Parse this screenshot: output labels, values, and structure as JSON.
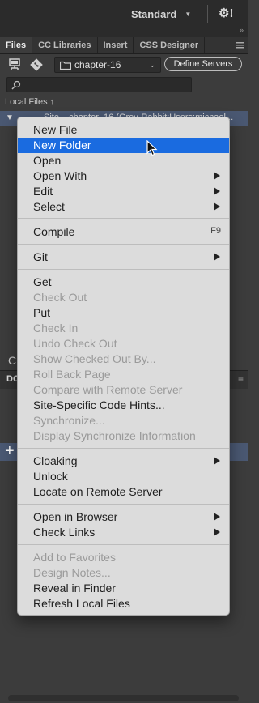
{
  "topbar": {
    "workspace": "Standard"
  },
  "tabs": [
    {
      "label": "Files",
      "active": true
    },
    {
      "label": "CC Libraries",
      "active": false
    },
    {
      "label": "Insert",
      "active": false
    },
    {
      "label": "CSS Designer",
      "active": false
    }
  ],
  "toolbar": {
    "site_name": "chapter-16",
    "define_servers": "Define Servers"
  },
  "files": {
    "local_files_label": "Local Files",
    "site_row_text": "Site – chapter_16 (Grey-Rabbit:Users:michael..."
  },
  "lower_panel": {
    "tab_label": "DO"
  },
  "context_menu": {
    "items": [
      {
        "label": "New File"
      },
      {
        "label": "New Folder",
        "selected": true
      },
      {
        "label": "Open"
      },
      {
        "label": "Open With",
        "submenu": true
      },
      {
        "label": "Edit",
        "submenu": true
      },
      {
        "label": "Select",
        "submenu": true
      },
      {
        "label": "Compile",
        "shortcut": "F9"
      },
      {
        "label": "Git",
        "submenu": true
      },
      {
        "label": "Get"
      },
      {
        "label": "Check Out",
        "disabled": true
      },
      {
        "label": "Put"
      },
      {
        "label": "Check In",
        "disabled": true
      },
      {
        "label": "Undo Check Out",
        "disabled": true
      },
      {
        "label": "Show Checked Out By...",
        "disabled": true
      },
      {
        "label": "Roll Back Page",
        "disabled": true
      },
      {
        "label": "Compare with Remote Server",
        "disabled": true
      },
      {
        "label": "Site-Specific Code Hints..."
      },
      {
        "label": "Synchronize...",
        "disabled": true
      },
      {
        "label": "Display Synchronize Information",
        "disabled": true
      },
      {
        "label": "Cloaking",
        "submenu": true
      },
      {
        "label": "Unlock"
      },
      {
        "label": "Locate on Remote Server"
      },
      {
        "label": "Open in Browser",
        "submenu": true
      },
      {
        "label": "Check Links",
        "submenu": true
      },
      {
        "label": "Add to Favorites",
        "disabled": true
      },
      {
        "label": "Design Notes...",
        "disabled": true
      },
      {
        "label": "Reveal in Finder"
      },
      {
        "label": "Refresh Local Files"
      }
    ]
  }
}
